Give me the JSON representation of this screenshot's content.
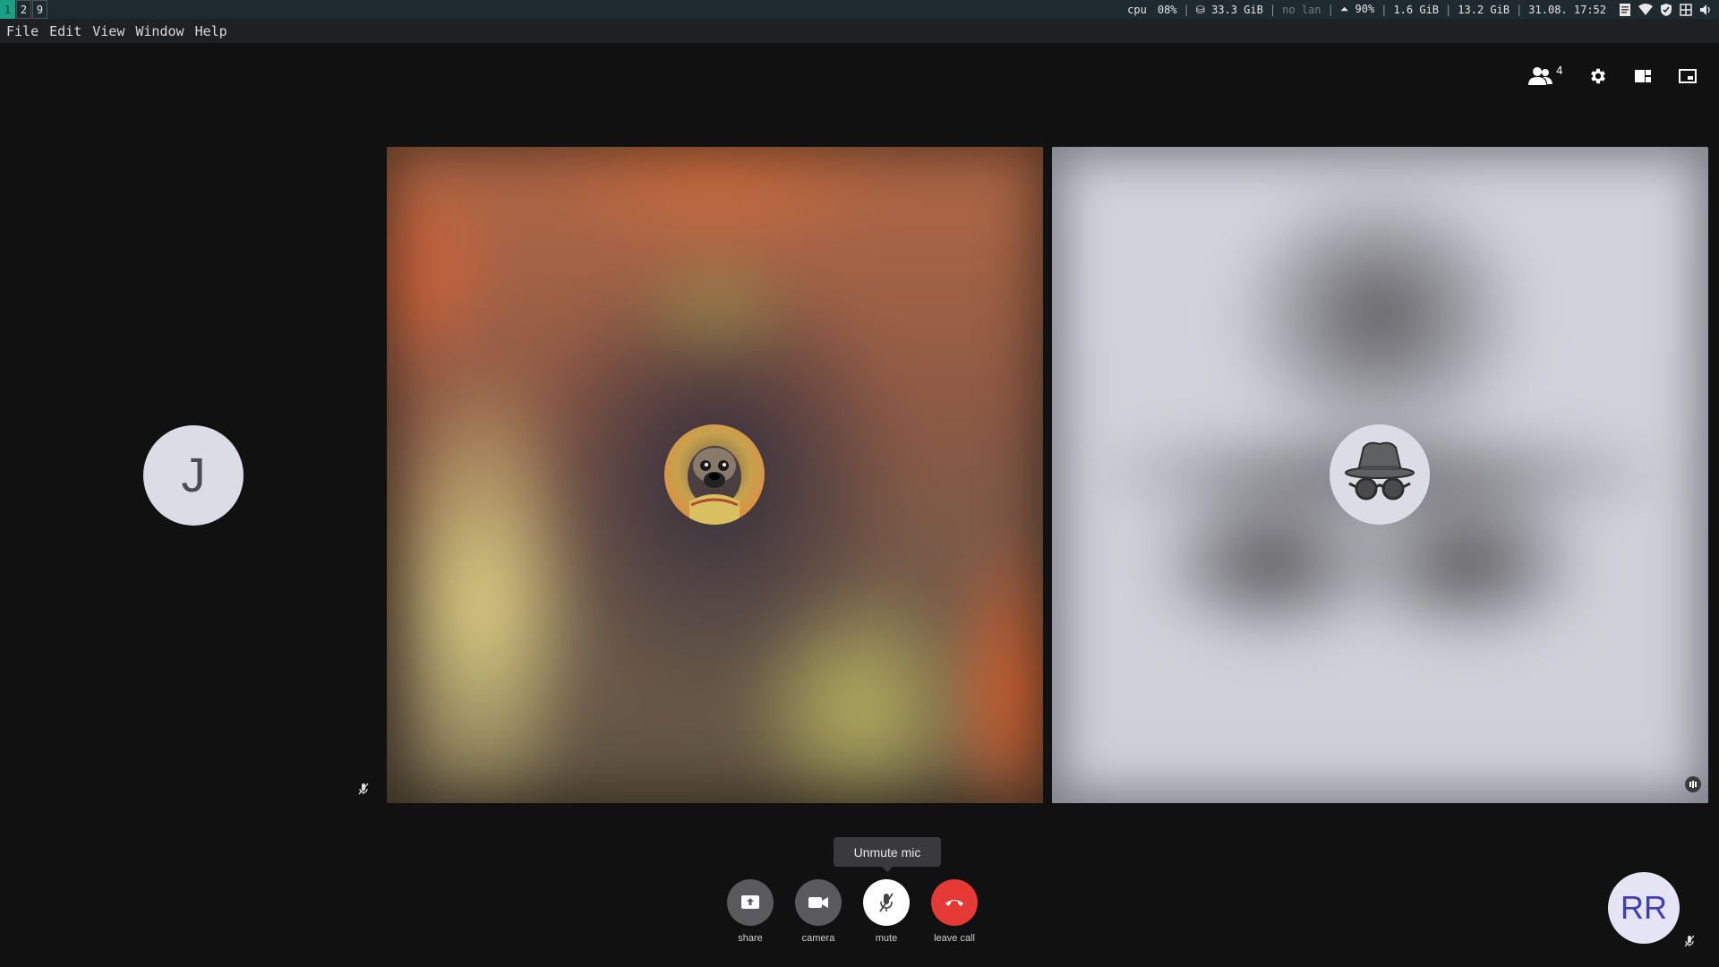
{
  "statusbar": {
    "workspaces": [
      "1",
      "2",
      "9"
    ],
    "cpu_label": "cpu",
    "cpu_value": "08%",
    "disk": "33.3 GiB",
    "lan": "no lan",
    "battery": "90%",
    "swap": "1.6 GiB",
    "mem": "13.2 GiB",
    "datetime": "31.08. 17:52"
  },
  "menubar": {
    "items": [
      "File",
      "Edit",
      "View",
      "Window",
      "Help"
    ]
  },
  "call_tools": {
    "participant_count": "4"
  },
  "participants": {
    "left_initial": "J",
    "self_initials": "RR"
  },
  "tooltip": "Unmute mic",
  "controls": {
    "share": "share",
    "camera": "camera",
    "mute": "mute",
    "leave": "leave call"
  },
  "colors": {
    "background": "#111111",
    "accent_workspace": "#19a186",
    "leave_red": "#e53935",
    "self_avatar_text": "#3f3fb5"
  }
}
